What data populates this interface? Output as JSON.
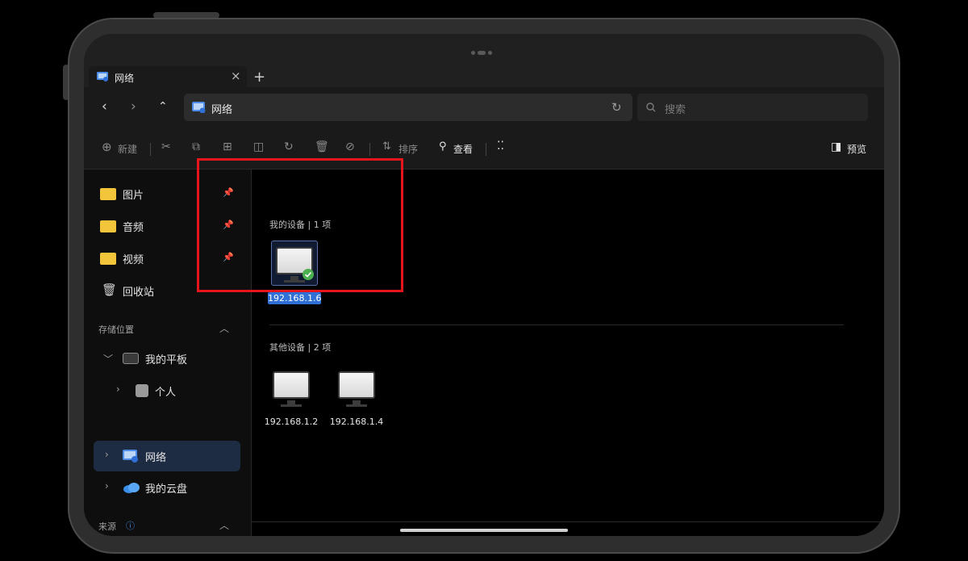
{
  "tab": {
    "title": "网络"
  },
  "address": {
    "path": "网络",
    "search_placeholder": "搜索"
  },
  "toolbar": {
    "new": "新建",
    "sort": "排序",
    "view": "查看",
    "preview": "预览"
  },
  "sidebar": {
    "quick": [
      {
        "label": "图片"
      },
      {
        "label": "音频"
      },
      {
        "label": "视频"
      },
      {
        "label": "回收站"
      }
    ],
    "storage_title": "存储位置",
    "tablet": "我的平板",
    "personal": "个人",
    "network": "网络",
    "cloud": "我的云盘",
    "source_title": "来源"
  },
  "main": {
    "my_devices": {
      "title": "我的设备 | 1 项",
      "items": [
        "192.168.1.6"
      ]
    },
    "other_devices": {
      "title": "其他设备 | 2 项",
      "items": [
        "192.168.1.2",
        "192.168.1.4"
      ]
    }
  },
  "colors": {
    "accent": "#2f6fd6",
    "highlight_box": "#e8141c",
    "folder": "#f3c53a"
  }
}
